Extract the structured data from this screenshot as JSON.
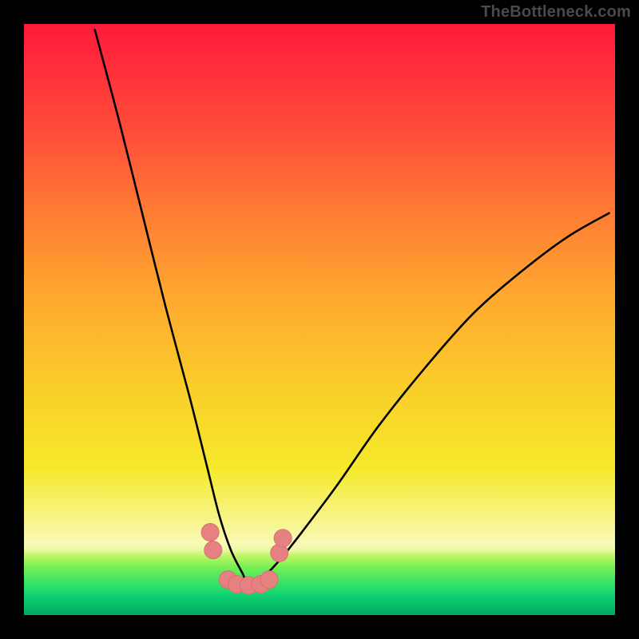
{
  "watermark": "TheBottleneck.com",
  "colors": {
    "frame": "#000000",
    "curve": "#000000",
    "marker_fill": "#e58181",
    "marker_stroke": "#d86f6f",
    "gradient_top": "#ff1a3a",
    "gradient_mid": "#f6e92b",
    "gradient_bottom": "#03a75e"
  },
  "chart_data": {
    "type": "line",
    "title": "",
    "xlabel": "",
    "ylabel": "",
    "xlim": [
      0,
      100
    ],
    "ylim": [
      0,
      100
    ],
    "grid": false,
    "legend": false,
    "note": "Bottleneck-style V-curve. Background gradient encodes performance band: red (bad) at top → green (good) at bottom. The black curve is a valley that bottoms out near x≈38, y≈5. Pink round markers are clustered around the valley floor.",
    "series": [
      {
        "name": "bottleneck_curve",
        "x": [
          12,
          16,
          20,
          24,
          28,
          31,
          33,
          35,
          37,
          38,
          40,
          43,
          47,
          53,
          60,
          68,
          76,
          84,
          92,
          99
        ],
        "y": [
          99,
          84,
          68,
          52,
          37,
          25,
          17,
          11,
          7,
          5,
          6,
          9,
          14,
          22,
          32,
          42,
          51,
          58,
          64,
          68
        ]
      },
      {
        "name": "markers",
        "x": [
          31.5,
          32.0,
          34.5,
          36.0,
          38.0,
          40.0,
          41.5,
          43.2,
          43.8
        ],
        "y": [
          14.0,
          11.0,
          6.0,
          5.2,
          5.0,
          5.2,
          6.0,
          10.5,
          13.0
        ]
      }
    ]
  }
}
